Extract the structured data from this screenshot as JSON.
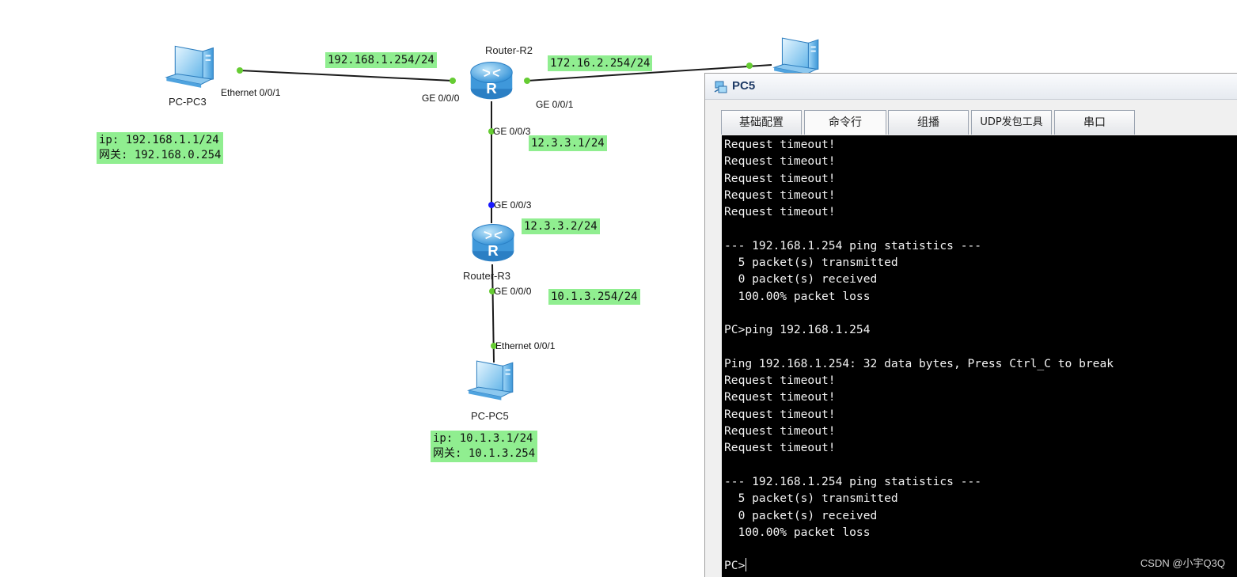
{
  "topology": {
    "devices": {
      "pc3": "PC-PC3",
      "r2": "Router-R2",
      "r3": "Router-R3",
      "pc5": "PC-PC5"
    },
    "ports": {
      "pc3_eth": "Ethernet 0/0/1",
      "r2_ge000": "GE 0/0/0",
      "r2_ge001": "GE 0/0/1",
      "r2_ge003": "GE 0/0/3",
      "r3_ge003": "GE 0/0/3",
      "r3_ge000": "GE 0/0/0",
      "pc5_eth": "Ethernet 0/0/1"
    },
    "ip_labels": {
      "r2_g0": "192.168.1.254/24",
      "r2_g1": "172.16.2.254/24",
      "r2_g3": "12.3.3.1/24",
      "r3_g3": "12.3.3.2/24",
      "r3_g0": "10.1.3.254/24"
    },
    "notes": {
      "pc3_ip": "ip: 192.168.1.1/24",
      "pc3_gw": "网关: 192.168.0.254",
      "pc5_ip": "ip: 10.1.3.1/24",
      "pc5_gw": "网关: 10.1.3.254"
    },
    "colors": {
      "label_bg": "#90ee90",
      "link": "#1a1a1a",
      "port_dot": "#66cc33",
      "port_dot_down": "#1a1aff"
    }
  },
  "pc5_window": {
    "title": "PC5",
    "icon": "pc-network-icon",
    "tabs": [
      {
        "label": "基础配置",
        "active": false
      },
      {
        "label": "命令行",
        "active": true
      },
      {
        "label": "组播",
        "active": false
      },
      {
        "label": "UDP发包工具",
        "active": false
      },
      {
        "label": "串口",
        "active": false
      }
    ],
    "terminal_lines": [
      "Request timeout!",
      "Request timeout!",
      "Request timeout!",
      "Request timeout!",
      "Request timeout!",
      "",
      "--- 192.168.1.254 ping statistics ---",
      "  5 packet(s) transmitted",
      "  0 packet(s) received",
      "  100.00% packet loss",
      "",
      "PC>ping 192.168.1.254",
      "",
      "Ping 192.168.1.254: 32 data bytes, Press Ctrl_C to break",
      "Request timeout!",
      "Request timeout!",
      "Request timeout!",
      "Request timeout!",
      "Request timeout!",
      "",
      "--- 192.168.1.254 ping statistics ---",
      "  5 packet(s) transmitted",
      "  0 packet(s) received",
      "  100.00% packet loss",
      ""
    ],
    "prompt": "PC>",
    "watermark": "CSDN @小宇Q3Q"
  }
}
